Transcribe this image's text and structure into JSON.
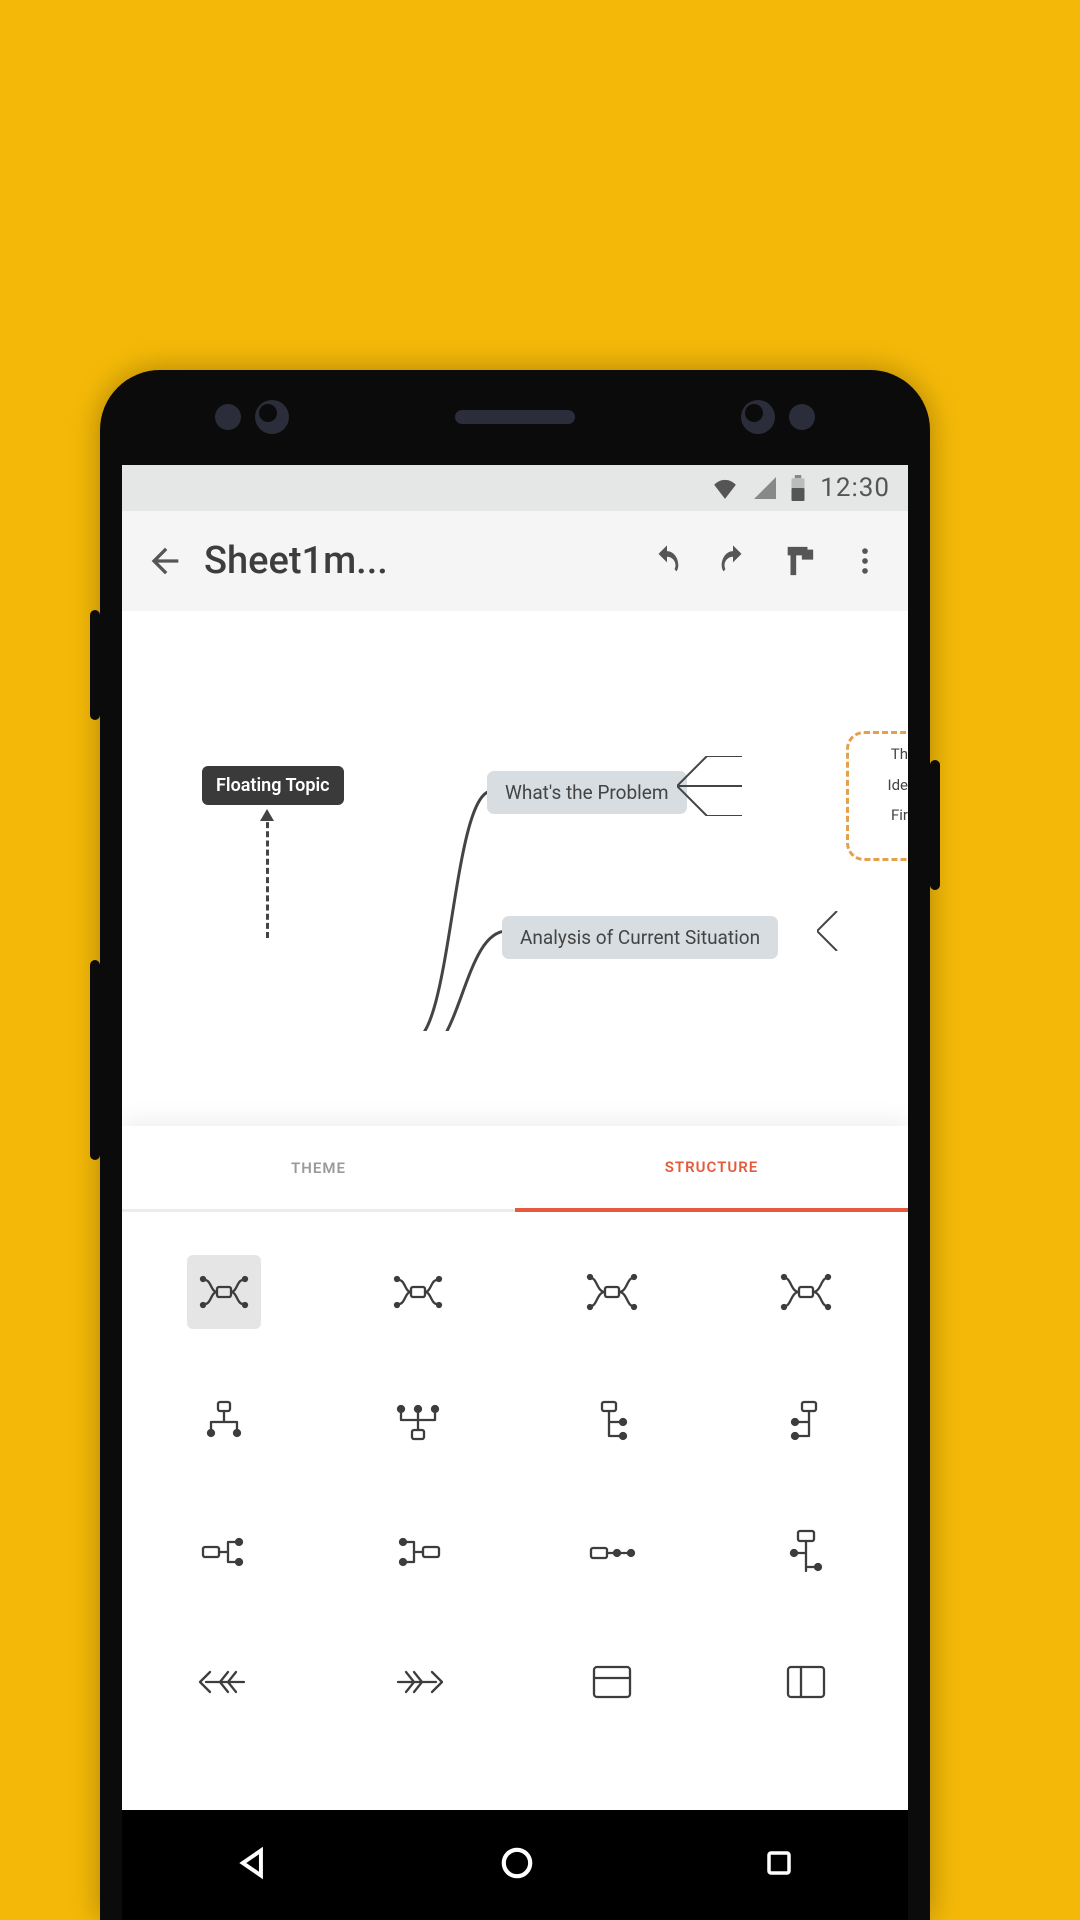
{
  "status": {
    "time": "12:30"
  },
  "toolbar": {
    "title": "Sheet1m..."
  },
  "canvas": {
    "floating": "Floating Topic",
    "node1": "What's the Problem",
    "node2": "Analysis of Current Situation",
    "mini1": "Th",
    "mini2": "Ide",
    "mini3": "Fir"
  },
  "tabs": {
    "theme": "THEME",
    "structure": "STRUCTURE"
  }
}
